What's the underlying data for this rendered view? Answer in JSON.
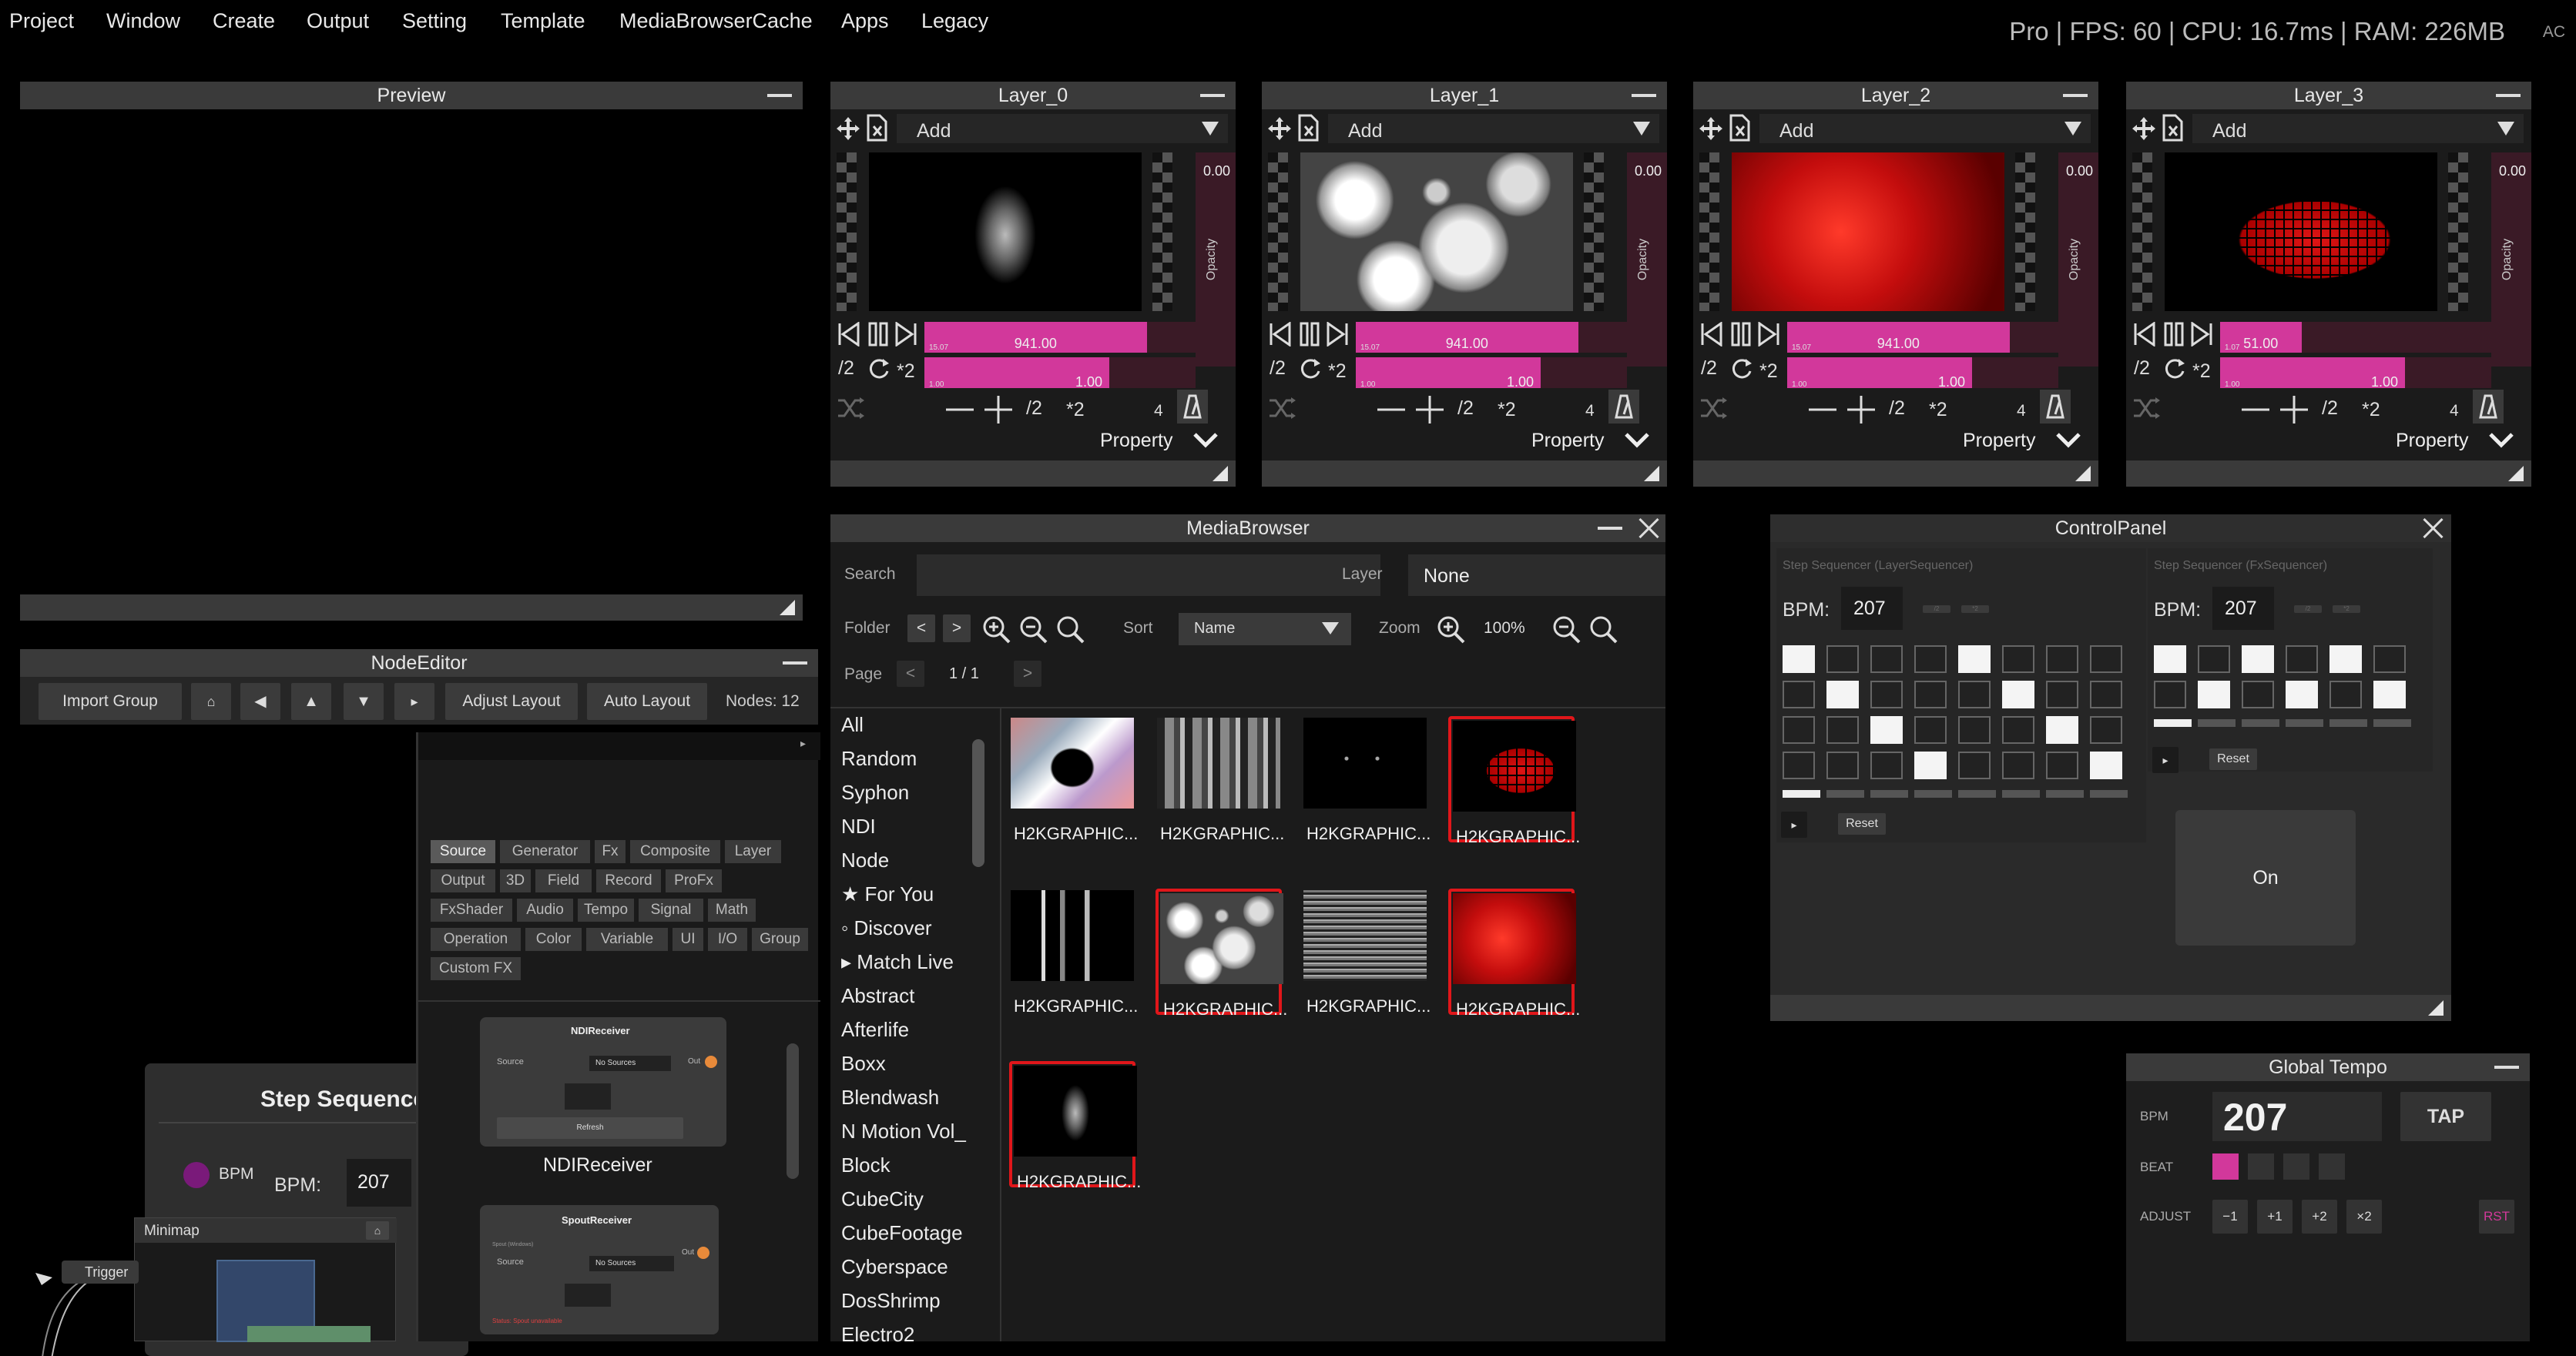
{
  "menu": [
    "Project",
    "Window",
    "Create",
    "Output",
    "Setting",
    "Template",
    "MediaBrowserCache",
    "Apps",
    "Legacy"
  ],
  "status": {
    "text": "Pro | FPS: 60 | CPU: 16.7ms | RAM: 226MB",
    "ac": "AC"
  },
  "preview": {
    "title": "Preview"
  },
  "layers": [
    {
      "title": "Layer_0",
      "add": "Add",
      "opacity": "0.00",
      "opacity_label": "Opacity",
      "speed": "941.00",
      "speed_sub": "15.07",
      "scale": "1.00",
      "scale_sub": "1.00",
      "count": "4",
      "property": "Property",
      "half": "/2",
      "double": "*2",
      "speed_fill": 0.82
    },
    {
      "title": "Layer_1",
      "add": "Add",
      "opacity": "0.00",
      "opacity_label": "Opacity",
      "speed": "941.00",
      "speed_sub": "15.07",
      "scale": "1.00",
      "scale_sub": "1.00",
      "count": "4",
      "property": "Property",
      "half": "/2",
      "double": "*2",
      "speed_fill": 0.82
    },
    {
      "title": "Layer_2",
      "add": "Add",
      "opacity": "0.00",
      "opacity_label": "Opacity",
      "speed": "941.00",
      "speed_sub": "15.07",
      "scale": "1.00",
      "scale_sub": "1.00",
      "count": "4",
      "property": "Property",
      "half": "/2",
      "double": "*2",
      "speed_fill": 0.82
    },
    {
      "title": "Layer_3",
      "add": "Add",
      "opacity": "0.00",
      "opacity_label": "Opacity",
      "speed": "51.00",
      "speed_sub": "1.07",
      "scale": "1.00",
      "scale_sub": "1.00",
      "count": "4",
      "property": "Property",
      "half": "/2",
      "double": "*2",
      "speed_fill": 0.3
    }
  ],
  "media_browser": {
    "title": "MediaBrowser",
    "search_label": "Search",
    "search_value": "",
    "layer_label": "Layer",
    "layer_value": "None",
    "folder_label": "Folder",
    "sort_label": "Sort",
    "sort_value": "Name",
    "zoom_label": "Zoom",
    "zoom_value": "100%",
    "page_label": "Page",
    "page_value": "1 / 1",
    "categories": [
      "All",
      "Random",
      "Syphon",
      "NDI",
      "Node",
      "★ For You",
      "◦ Discover",
      "▸ Match Live",
      "Abstract",
      "Afterlife",
      "Boxx",
      "Blendwash",
      "N Motion Vol_",
      "Block",
      "CubeCity",
      "CubeFootage",
      "Cyberspace",
      "DosShrimp",
      "Electro2"
    ],
    "items": [
      {
        "name": "H2KGRAPHIC...",
        "selected": false,
        "style": "marble"
      },
      {
        "name": "H2KGRAPHIC...",
        "selected": false,
        "style": "grey"
      },
      {
        "name": "H2KGRAPHIC...",
        "selected": false,
        "style": "dots"
      },
      {
        "name": "H2KGRAPHIC...",
        "selected": true,
        "style": "redgrid"
      },
      {
        "name": "H2KGRAPHIC...",
        "selected": false,
        "style": "bars"
      },
      {
        "name": "H2KGRAPHIC...",
        "selected": true,
        "style": "spheres"
      },
      {
        "name": "H2KGRAPHIC...",
        "selected": false,
        "style": "noise"
      },
      {
        "name": "H2KGRAPHIC...",
        "selected": true,
        "style": "redfur"
      },
      {
        "name": "H2KGRAPHIC...",
        "selected": true,
        "style": "figure"
      }
    ]
  },
  "control_panel": {
    "title": "ControlPanel",
    "left": {
      "heading": "Step Sequencer (LayerSequencer)",
      "bpm_label": "BPM:",
      "bpm": "207",
      "reset": "Reset",
      "play": "▸",
      "half": "/2",
      "double": "*2"
    },
    "right": {
      "heading": "Step Sequencer (FxSequencer)",
      "bpm_label": "BPM:",
      "bpm": "207",
      "reset": "Reset",
      "play": "▸",
      "half": "/2",
      "double": "*2"
    },
    "on_label": "On",
    "grid_left": [
      [
        1,
        0,
        0,
        0,
        1,
        0,
        0,
        0
      ],
      [
        0,
        1,
        0,
        0,
        0,
        1,
        0,
        0
      ],
      [
        0,
        0,
        1,
        0,
        0,
        0,
        1,
        0
      ],
      [
        0,
        0,
        0,
        1,
        0,
        0,
        0,
        1
      ]
    ],
    "grid_right": [
      [
        1,
        0,
        1,
        0,
        1,
        0
      ],
      [
        0,
        1,
        0,
        1,
        0,
        1
      ]
    ]
  },
  "node_editor": {
    "title": "NodeEditor",
    "toolbar": {
      "import": "Import Group",
      "home": "⌂",
      "left": "◀",
      "up": "▲",
      "down": "▼",
      "more": "▸",
      "adjust": "Adjust Layout",
      "auto": "Auto Layout",
      "nodes": "Nodes: 12"
    },
    "tags": [
      "Source",
      "Generator",
      "Fx",
      "Composite",
      "Layer",
      "Output",
      "3D",
      "Field",
      "Record",
      "ProFx",
      "FxShader",
      "Audio",
      "Tempo",
      "Signal",
      "Math",
      "Operation",
      "Color",
      "Variable",
      "UI",
      "I/O",
      "Group",
      "Custom FX"
    ],
    "ndi": {
      "title": "NDIReceiver",
      "source": "Source",
      "value": "No Sources",
      "out": "Out",
      "refresh": "Refresh",
      "label": "NDIReceiver"
    },
    "spout": {
      "title": "SpoutReceiver",
      "line1": "Spout (Windows)",
      "source": "Source",
      "value": "No Sources",
      "out": "Out",
      "warn": "Status: Spout unavailable"
    },
    "step": {
      "title": "Step Sequence",
      "bpm_port": "BPM",
      "bpm_label": "BPM:",
      "bpm": "207"
    },
    "minimap": {
      "title": "Minimap",
      "home": "⌂"
    },
    "trigger": "Trigger"
  },
  "global_tempo": {
    "title": "Global Tempo",
    "bpm_label": "BPM",
    "bpm": "207",
    "tap": "TAP",
    "beat_label": "BEAT",
    "adjust_label": "ADJUST",
    "adjust": [
      "−1",
      "+1",
      "+2",
      "×2"
    ],
    "rst": "RST",
    "beat_active": 0
  },
  "colors": {
    "accent": "#d2389b",
    "select": "#e0161a",
    "panel": "#1b1b1b",
    "title": "#3a3a3a"
  }
}
